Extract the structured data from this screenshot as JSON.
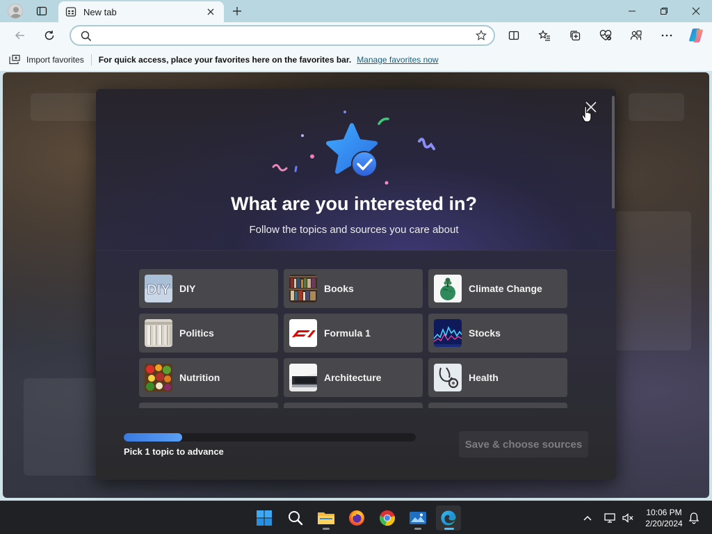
{
  "browser": {
    "tab_title": "New tab",
    "address_placeholder": "",
    "favorites_bar": {
      "import_label": "Import favorites",
      "hint_text": "For quick access, place your favorites here on the favorites bar.",
      "manage_link": "Manage favorites now"
    }
  },
  "modal": {
    "title": "What are you interested in?",
    "subtitle": "Follow the topics and sources you care about",
    "topics": [
      {
        "label": "DIY",
        "icon": "diy-icon"
      },
      {
        "label": "Books",
        "icon": "books-icon"
      },
      {
        "label": "Climate Change",
        "icon": "climate-change-icon"
      },
      {
        "label": "Politics",
        "icon": "politics-icon"
      },
      {
        "label": "Formula 1",
        "icon": "formula-1-icon"
      },
      {
        "label": "Stocks",
        "icon": "stocks-icon"
      },
      {
        "label": "Nutrition",
        "icon": "nutrition-icon"
      },
      {
        "label": "Architecture",
        "icon": "architecture-icon"
      },
      {
        "label": "Health",
        "icon": "health-icon"
      }
    ],
    "progress_fraction": 0.2,
    "progress_text": "Pick 1 topic to advance",
    "save_button": "Save & choose sources"
  },
  "taskbar": {
    "apps": [
      "start-icon",
      "search-icon",
      "file-explorer-icon",
      "firefox-icon",
      "chrome-icon",
      "photos-icon",
      "edge-icon"
    ],
    "active_app": "edge-icon",
    "time": "10:06 PM",
    "date": "2/20/2024"
  },
  "colors": {
    "accent": "#4aa3f0",
    "modal_bg": "#2b2a3e",
    "tile_bg": "#48474c"
  }
}
